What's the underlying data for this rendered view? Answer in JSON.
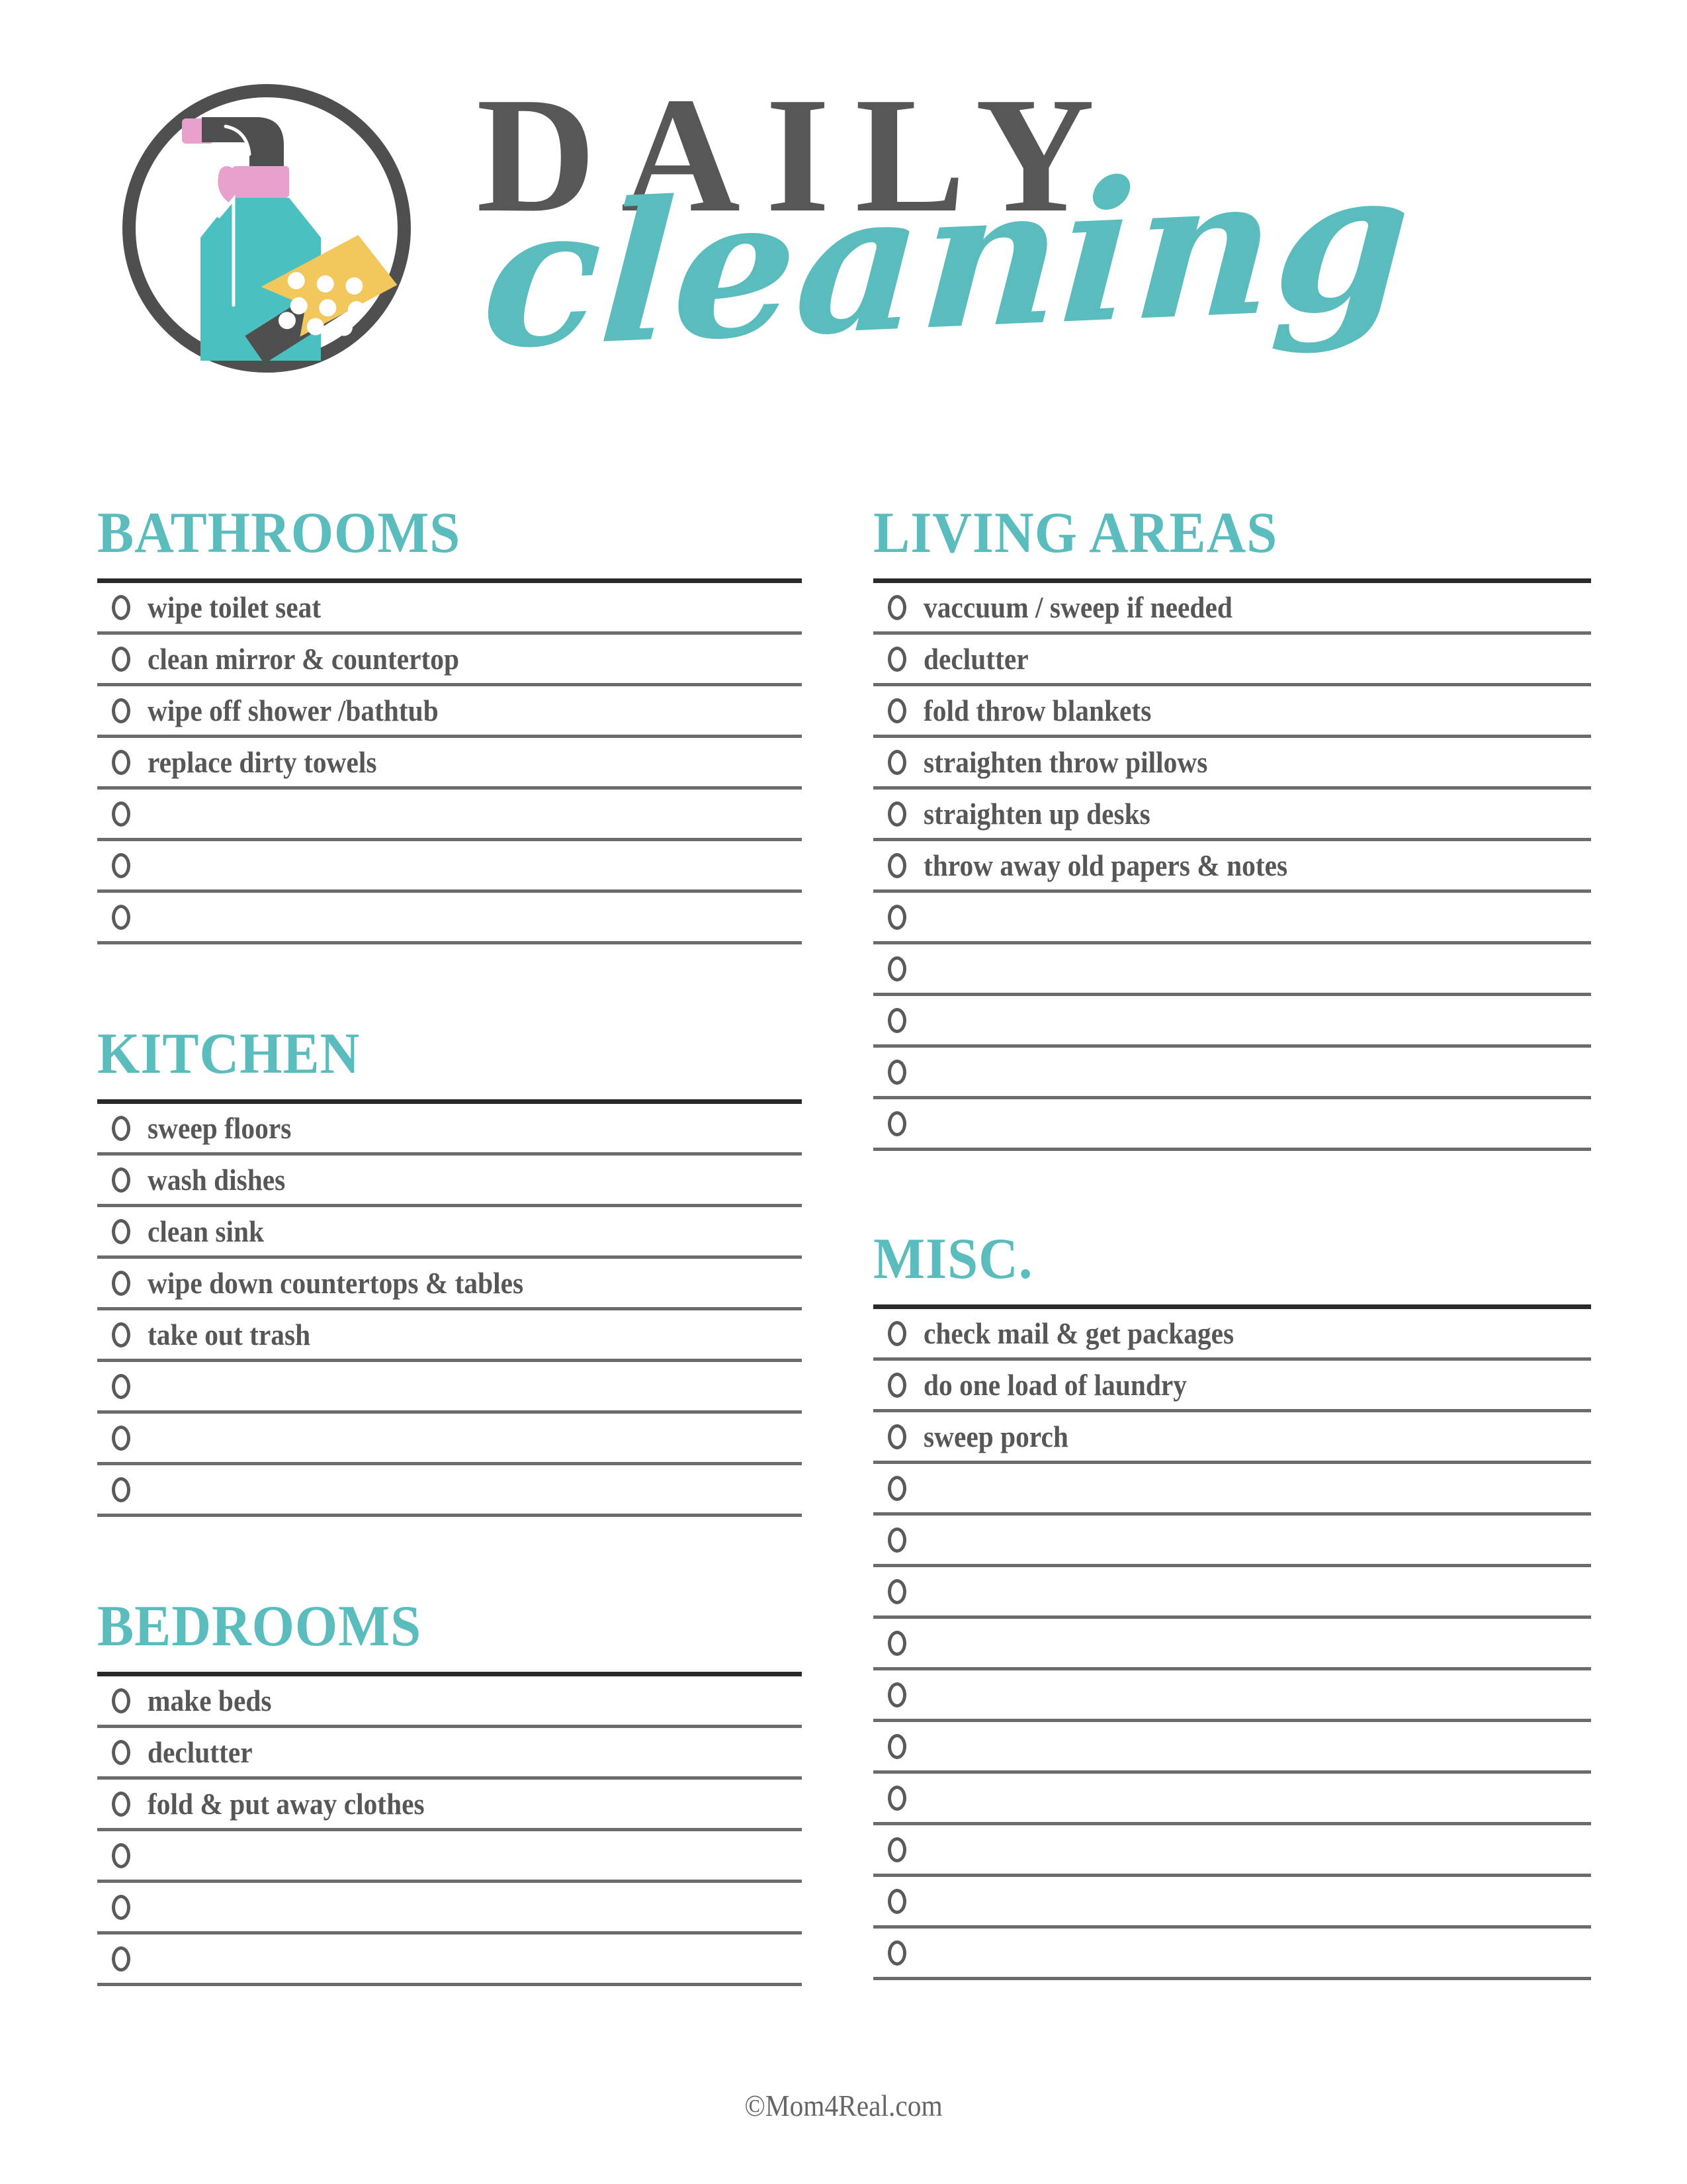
{
  "page": {
    "title_main": "DAILY",
    "title_script": "cleaning",
    "footer": "©Mom4Real.com"
  },
  "colors": {
    "teal": "#5BBCBE",
    "dark_gray": "#575757",
    "pink": "#E8A0CC",
    "yellow": "#F2C75C",
    "rule": "#6B6B6B",
    "rule_top": "#2A2A2A"
  },
  "logo": {
    "name": "spray-bottle-and-sponge-logo",
    "ring_color": "#4F4F4F",
    "bottle_color": "#4BC0C0",
    "cap_color": "#E8A0CC",
    "nozzle_color": "#4F4F4F",
    "sponge_color": "#F2C75C",
    "squeegee_color": "#4F4F4F"
  },
  "columns": {
    "left": [
      {
        "id": "bathrooms",
        "title": "BATHROOMS",
        "items": [
          "wipe toilet seat",
          "clean mirror & countertop",
          "wipe off shower /bathtub",
          "replace dirty towels",
          "",
          "",
          ""
        ]
      },
      {
        "id": "kitchen",
        "title": "KITCHEN",
        "items": [
          "sweep floors",
          "wash dishes",
          "clean sink",
          "wipe down countertops & tables",
          "take out trash",
          "",
          "",
          ""
        ]
      },
      {
        "id": "bedrooms",
        "title": "BEDROOMS",
        "items": [
          "make beds",
          "declutter",
          "fold & put away clothes",
          "",
          "",
          ""
        ]
      }
    ],
    "right": [
      {
        "id": "living-areas",
        "title": "LIVING AREAS",
        "items": [
          "vaccuum / sweep if needed",
          "declutter",
          "fold throw blankets",
          "straighten throw pillows",
          "straighten up desks",
          "throw away old papers & notes",
          "",
          "",
          "",
          "",
          ""
        ]
      },
      {
        "id": "misc",
        "title": "MISC.",
        "items": [
          "check mail & get packages",
          "do one load of laundry",
          "sweep porch",
          "",
          "",
          "",
          "",
          "",
          "",
          "",
          "",
          "",
          ""
        ]
      }
    ]
  }
}
